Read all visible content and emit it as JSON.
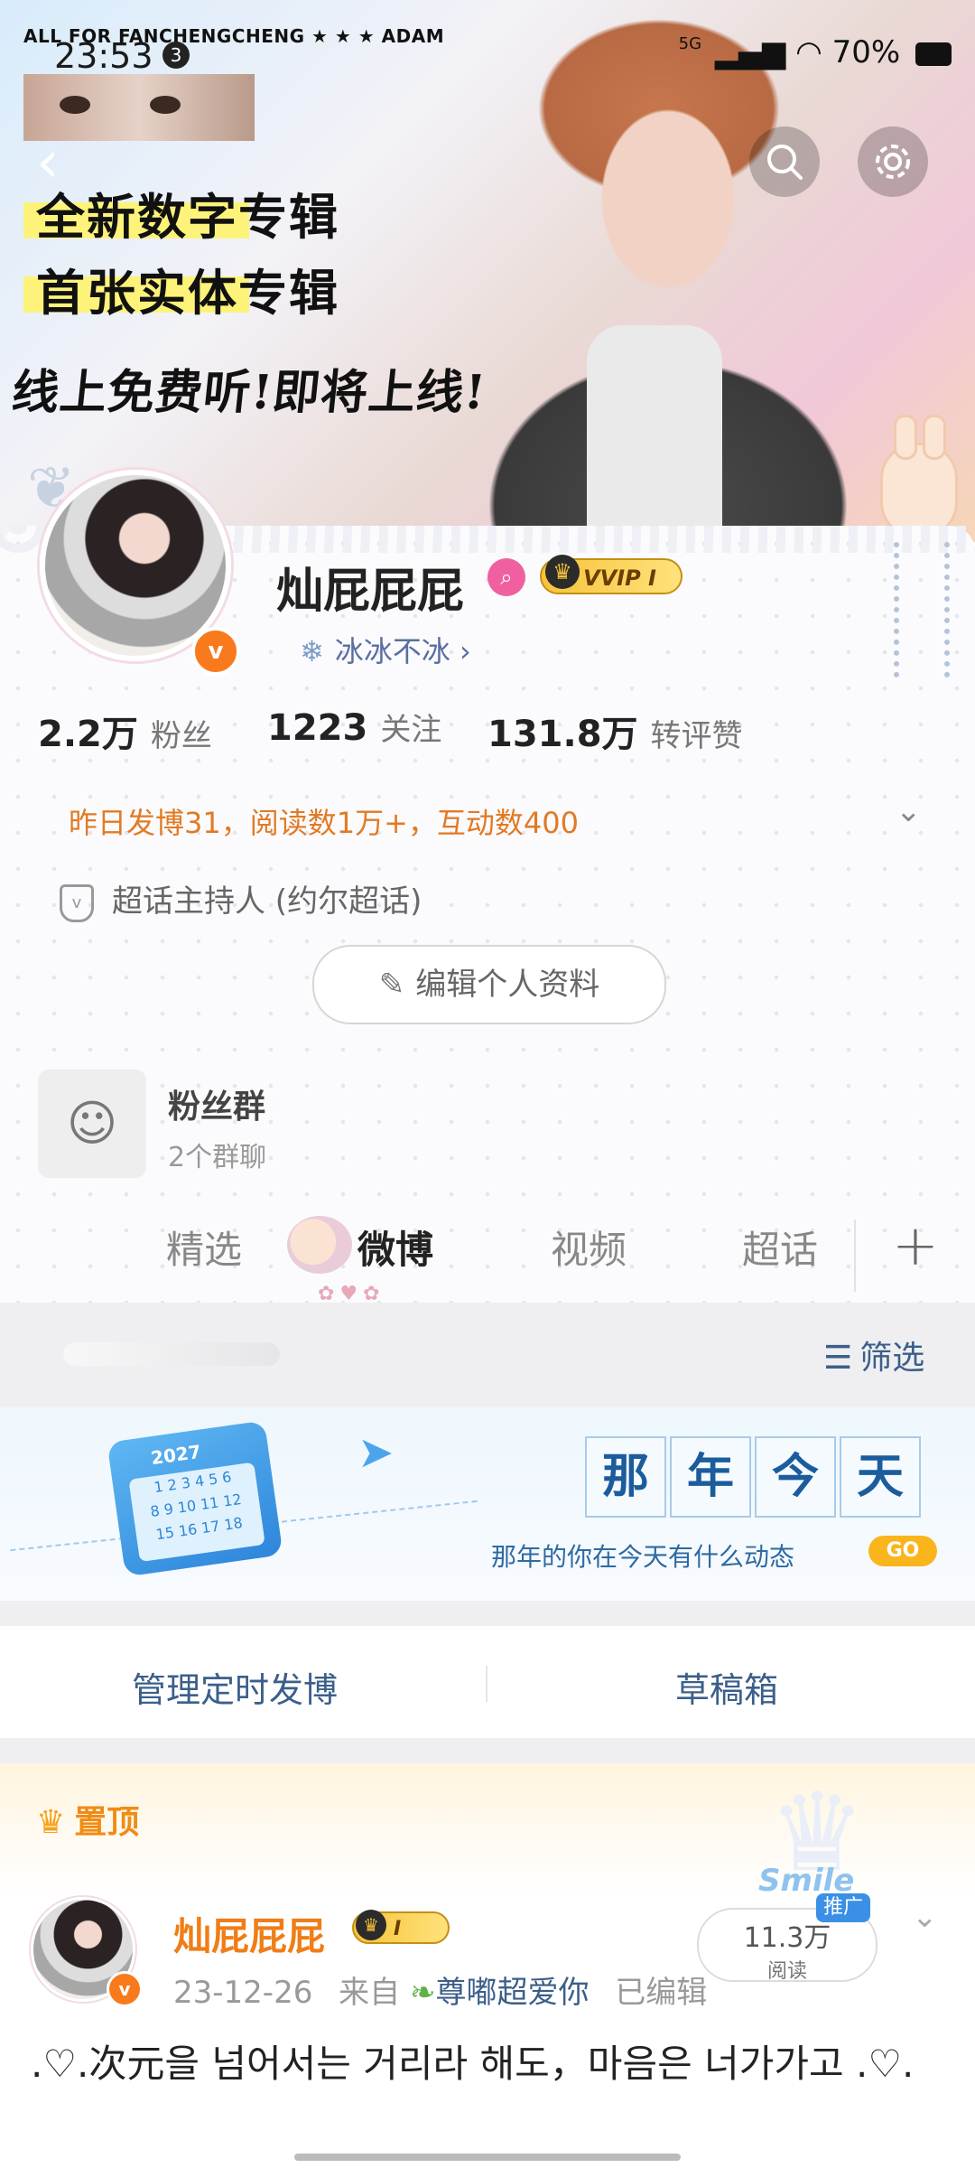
{
  "status_bar": {
    "banner_text": "ALL FOR FANCHENGCHENG ★ ★ ★ ADAM",
    "time": "23:53",
    "notification_count": "3",
    "network": "5G",
    "battery": "70%"
  },
  "header_promo": {
    "line1": "全新数字专辑",
    "line2": "首张实体专辑",
    "line3": "线上免费听!即将上线!"
  },
  "profile": {
    "username": "灿屁屁屁",
    "vip_label": "VVIP I",
    "sub_link": "冰冰不冰",
    "stats": [
      {
        "value": "2.2万",
        "label": "粉丝"
      },
      {
        "value": "1223",
        "label": "关注"
      },
      {
        "value": "131.8万",
        "label": "转评赞"
      }
    ],
    "activity": "昨日发博31，阅读数1万+，互动数400",
    "host_role": "超话主持人 (约尔超话)",
    "edit_button": "编辑个人资料"
  },
  "fan_group": {
    "title": "粉丝群",
    "subtitle": "2个群聊"
  },
  "tabs": [
    {
      "label": "精选",
      "active": false
    },
    {
      "label": "微博",
      "active": true
    },
    {
      "label": "视频",
      "active": false
    },
    {
      "label": "超话",
      "active": false
    }
  ],
  "filter": {
    "label": "筛选"
  },
  "memories_banner": {
    "year": "2027",
    "title_chars": [
      "那",
      "年",
      "今",
      "天"
    ],
    "subtitle": "那年的你在今天有什么动态",
    "go": "GO"
  },
  "manage_bar": {
    "scheduled": "管理定时发博",
    "drafts": "草稿箱"
  },
  "pinned_post": {
    "pin_label": "置顶",
    "author": "灿屁屁屁",
    "vip_label": "I",
    "date": "23-12-26",
    "source_prefix": "来自",
    "source": "尊嘟超爱你",
    "edited": "已编辑",
    "read_count": "11.3万",
    "read_label": "阅读",
    "promo_tag": "推广",
    "text": ".♡.次元을 넘어서는 거리라 해도，마음은 너가가고 .♡."
  },
  "colors": {
    "accent_orange": "#f07d16",
    "link_blue": "#3b5f8a",
    "vip_gold": "#f7c33a"
  }
}
